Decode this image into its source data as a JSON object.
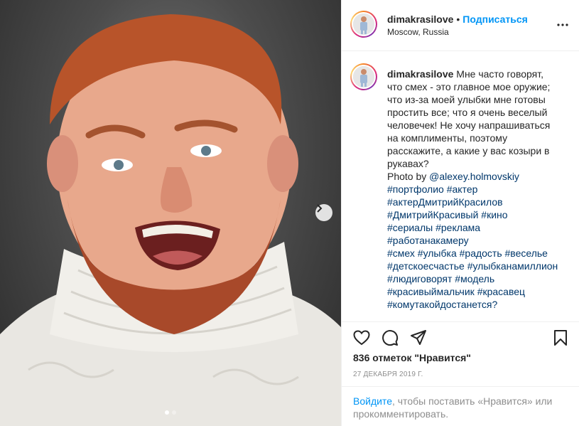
{
  "post": {
    "username": "dimakrasilove",
    "separator": "•",
    "follow_label": "Подписаться",
    "location": "Moscow, Russia"
  },
  "caption": {
    "username": "dimakrasilove",
    "text_lines": [
      "Мне часто говорят,",
      "что смех - это главное мое оружие;",
      "что из-за моей улыбки мне готовы",
      "простить все; что я очень веселый",
      "человечек! Не хочу напрашиваться",
      "на комплименты, поэтому",
      "расскажите, а какие у вас козыри в",
      "рукавах?"
    ],
    "photo_by_prefix": "Photo by ",
    "photo_by_mention": "@alexey.holmovskiy",
    "hashtag_lines": [
      "#портфолио #актер",
      "#актерДмитрийКрасилов",
      "#ДмитрийКрасивый #кино",
      "#сериалы #реклама",
      "#работанакамеру",
      "#смех #улыбка #радость #веселье",
      "#детскоесчастье #улыбканамиллион",
      "#людиговорят #модель",
      "#красивыймальчик #красавец",
      "#комутакойдостанется?"
    ]
  },
  "stats": {
    "likes": "836 отметок \"Нравится\"",
    "date": "27 ДЕКАБРЯ 2019 Г."
  },
  "login_prompt": {
    "link": "Войдите",
    "rest": ", чтобы поставить «Нравится» или прокомментировать."
  },
  "carousel": {
    "slide_count": 2,
    "active_index": 0
  },
  "icons": {
    "more": "more-horizontal-icon",
    "like": "heart-icon",
    "comment": "comment-icon",
    "share": "paper-plane-icon",
    "save": "bookmark-icon",
    "next": "chevron-right-icon"
  },
  "colors": {
    "link_blue": "#0095f6",
    "hashtag_blue": "#00376b",
    "muted": "#8e8e8e",
    "text": "#262626",
    "border": "#efefef"
  }
}
